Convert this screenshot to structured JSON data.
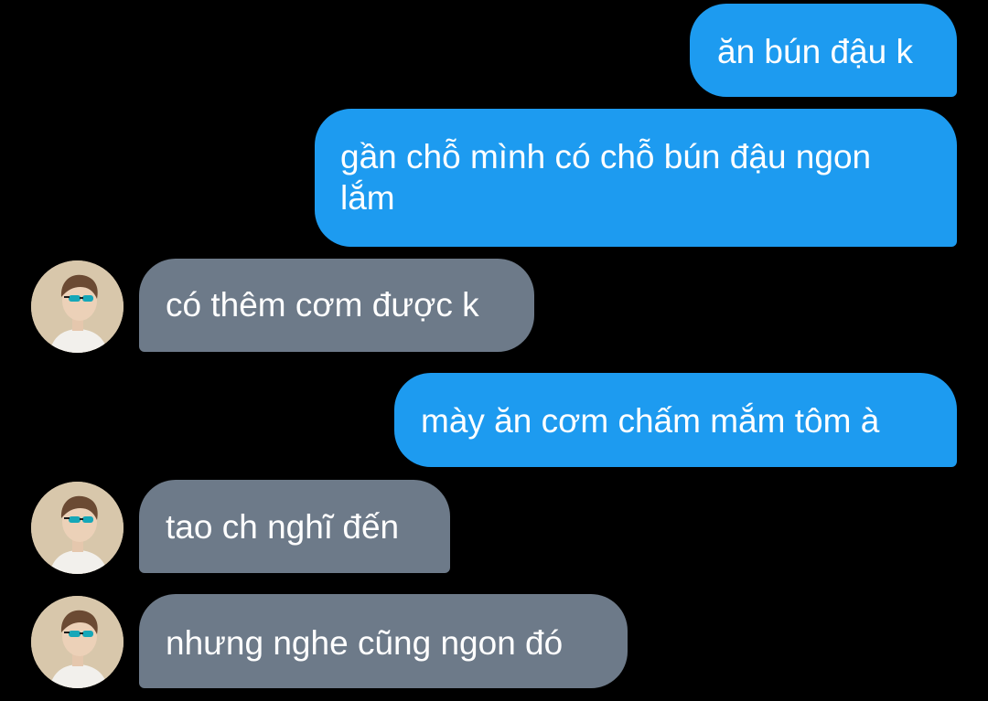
{
  "conversation": {
    "messages": [
      {
        "direction": "sent",
        "text": "ăn bún đậu k"
      },
      {
        "direction": "sent",
        "text": "gần chỗ mình có chỗ bún đậu ngon lắm"
      },
      {
        "direction": "received",
        "text": "có thêm cơm được k"
      },
      {
        "direction": "sent",
        "text": "mày ăn cơm chấm mắm tôm à"
      },
      {
        "direction": "received",
        "text": "tao ch nghĩ đến"
      },
      {
        "direction": "received",
        "text": "nhưng nghe cũng ngon đó"
      }
    ]
  },
  "colors": {
    "background": "#000000",
    "sent_bubble": "#1d9bf0",
    "received_bubble": "#6d7a89",
    "text": "#ffffff"
  },
  "icons": {
    "avatar": "contact-avatar-photo"
  }
}
